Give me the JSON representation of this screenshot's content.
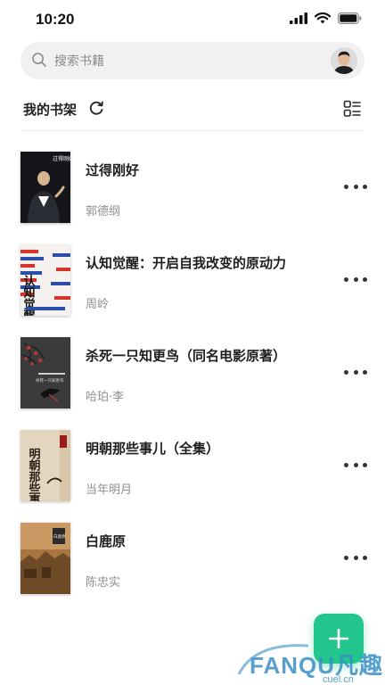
{
  "status_bar": {
    "time": "10:20"
  },
  "search": {
    "placeholder": "搜索书籍"
  },
  "shelf": {
    "title": "我的书架"
  },
  "books": [
    {
      "title": "过得刚好",
      "author": "郭德纲",
      "cover_text": "过得刚好"
    },
    {
      "title": "认知觉醒：开启自我改变的原动力",
      "author": "周岭",
      "cover_text": "认知觉醒"
    },
    {
      "title": "杀死一只知更鸟（同名电影原著）",
      "author": "哈珀·李",
      "cover_text": "杀死一只知更鸟"
    },
    {
      "title": "明朝那些事儿（全集）",
      "author": "当年明月",
      "cover_text": "明朝那些事儿"
    },
    {
      "title": "白鹿原",
      "author": "陈忠实",
      "cover_text": "白鹿原"
    }
  ],
  "watermark": {
    "brand": "FANQU凡趣",
    "domain": "cuel.cn"
  },
  "colors": {
    "accent": "#22c58b",
    "text_secondary": "#8f8f95"
  }
}
